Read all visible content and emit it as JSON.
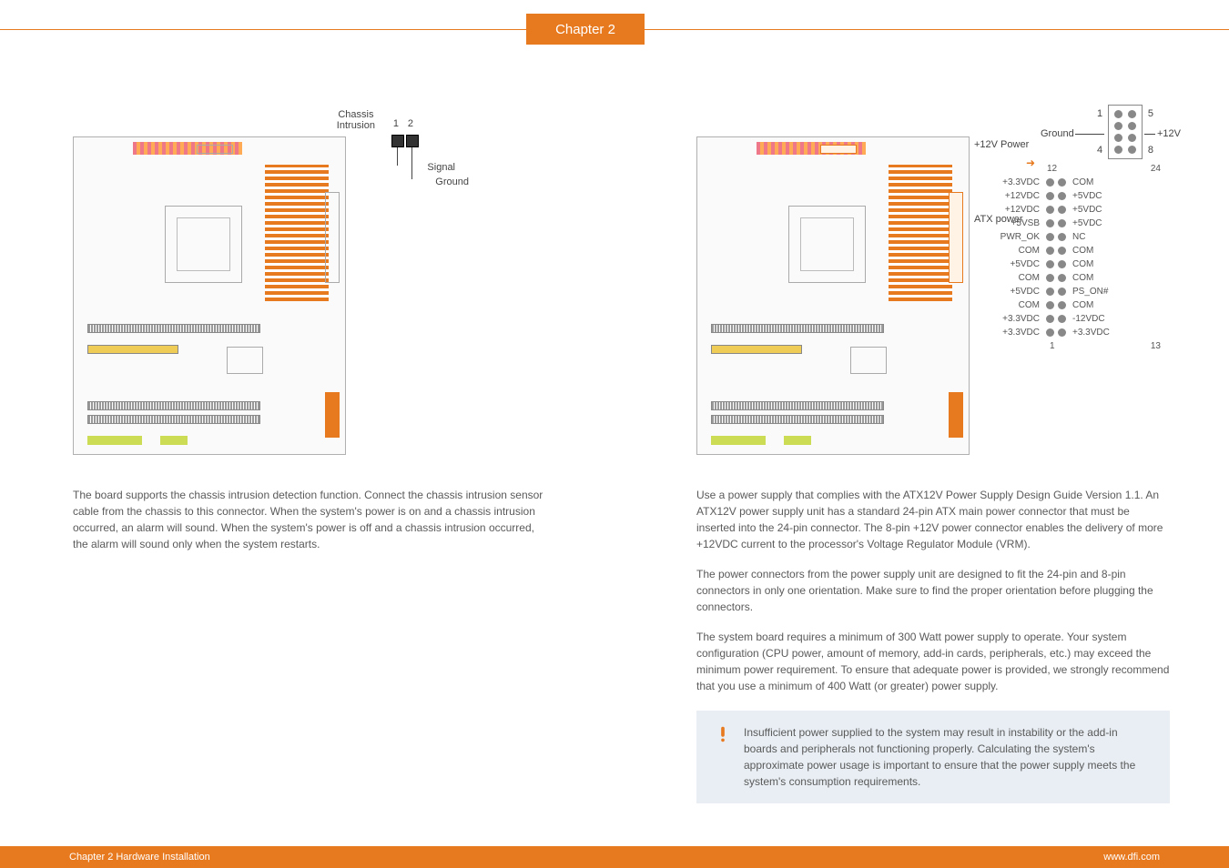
{
  "header": {
    "tab": "Chapter 2"
  },
  "left": {
    "labels": {
      "chassis": "Chassis\nIntrusion",
      "num1": "1",
      "num2": "2",
      "signal": "Signal",
      "ground": "Ground"
    },
    "body": "The board supports the chassis intrusion detection function. Connect the chassis intrusion sensor cable from the chassis to this connector. When the system's power is on and a chassis intrusion occurred, an alarm will sound. When the system's power is off and a chassis intrusion occurred, the alarm will sound only when the system restarts."
  },
  "right": {
    "labels": {
      "atx12v": "+12V Power",
      "atx": "ATX power",
      "ground": "Ground",
      "p12v": "+12V",
      "pin8": {
        "p1": "1",
        "p5": "5",
        "p4": "4",
        "p8": "8"
      },
      "atx24": {
        "top12": "12",
        "top24": "24",
        "bot1": "1",
        "bot13": "13",
        "left": [
          "+3.3VDC",
          "+12VDC",
          "+12VDC",
          "+5VSB",
          "PWR_OK",
          "COM",
          "+5VDC",
          "COM",
          "+5VDC",
          "COM",
          "+3.3VDC",
          "+3.3VDC"
        ],
        "right": [
          "COM",
          "+5VDC",
          "+5VDC",
          "+5VDC",
          "NC",
          "COM",
          "COM",
          "COM",
          "PS_ON#",
          "COM",
          "-12VDC",
          "+3.3VDC"
        ]
      }
    },
    "p1": "Use a power supply that complies with the ATX12V Power Supply Design Guide Version 1.1. An ATX12V power supply unit has a standard 24-pin ATX main power connector that must be inserted into the 24-pin connector. The 8-pin +12V power connector enables the delivery of more +12VDC current to the processor's Voltage Regulator Module (VRM).",
    "p2": "The power connectors from the power supply unit are designed to fit the 24-pin and 8-pin connectors in only one orientation. Make sure to find the proper orientation before plugging the connectors.",
    "p3": "The system board requires a minimum of 300 Watt power supply to operate. Your system configuration (CPU power, amount of memory, add-in cards, peripherals, etc.) may exceed the minimum power requirement. To ensure that adequate power is provided, we strongly recommend that you use a minimum of 400 Watt (or greater) power supply.",
    "note": "Insufficient power supplied to the system may result in instability or the add-in boards and peripherals not functioning properly. Calculating the system's approximate power usage is important to ensure that the power supply meets the system's consumption requirements."
  },
  "footer": {
    "left": "Chapter 2 Hardware Installation",
    "right": "www.dfi.com"
  }
}
